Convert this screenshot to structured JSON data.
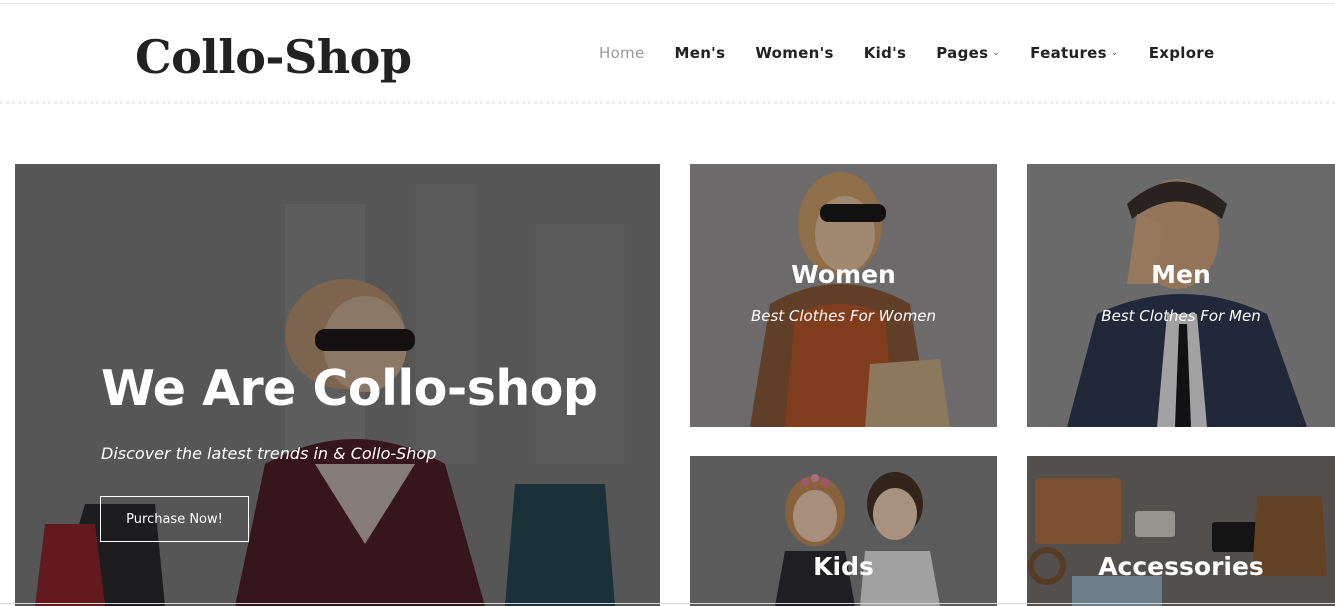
{
  "brand": {
    "logo_text": "Collo-Shop"
  },
  "nav": {
    "items": [
      {
        "label": "Home",
        "active": true,
        "dropdown": false
      },
      {
        "label": "Men's",
        "active": false,
        "dropdown": false
      },
      {
        "label": "Women's",
        "active": false,
        "dropdown": false
      },
      {
        "label": "Kid's",
        "active": false,
        "dropdown": false
      },
      {
        "label": "Pages",
        "active": false,
        "dropdown": true
      },
      {
        "label": "Features",
        "active": false,
        "dropdown": true
      },
      {
        "label": "Explore",
        "active": false,
        "dropdown": false
      }
    ],
    "dropdown_icon": "chevron-down-icon"
  },
  "hero": {
    "title": "We Are Collo-shop",
    "subtitle": "Discover the latest trends in & Collo-Shop",
    "button_label": "Purchase Now!"
  },
  "categories": {
    "women": {
      "title": "Women",
      "subtitle": "Best Clothes For Women"
    },
    "men": {
      "title": "Men",
      "subtitle": "Best Clothes For Men"
    },
    "kids": {
      "title": "Kids"
    },
    "accessories": {
      "title": "Accessories"
    }
  },
  "colors": {
    "text_dark": "#222222",
    "nav_active": "#9a9a9a",
    "overlay_text": "#ffffff"
  }
}
